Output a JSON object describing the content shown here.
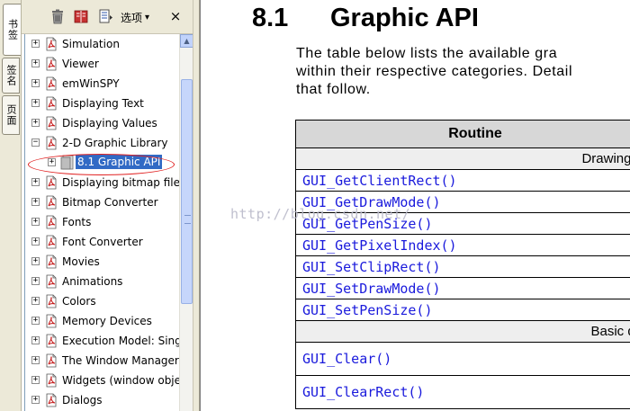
{
  "left_tabs": [
    "书签",
    "签名",
    "页面"
  ],
  "toolbar": {
    "options_label": "选项",
    "options_arrow": "▾",
    "close_label": "×"
  },
  "bookmarks": {
    "items": [
      {
        "label": "Simulation",
        "expander": "+"
      },
      {
        "label": "Viewer",
        "expander": "+"
      },
      {
        "label": "emWinSPY",
        "expander": "+"
      },
      {
        "label": "Displaying Text",
        "expander": "+"
      },
      {
        "label": "Displaying Values",
        "expander": "+"
      },
      {
        "label": "2-D Graphic Library",
        "expander": "−"
      },
      {
        "label": "8.1 Graphic API",
        "expander": "+",
        "selected": true
      },
      {
        "label": "Displaying bitmap files",
        "expander": "+"
      },
      {
        "label": "Bitmap Converter",
        "expander": "+"
      },
      {
        "label": "Fonts",
        "expander": "+"
      },
      {
        "label": "Font Converter",
        "expander": "+"
      },
      {
        "label": "Movies",
        "expander": "+"
      },
      {
        "label": "Animations",
        "expander": "+"
      },
      {
        "label": "Colors",
        "expander": "+"
      },
      {
        "label": "Memory Devices",
        "expander": "+"
      },
      {
        "label": "Execution Model: Singl",
        "expander": "+"
      },
      {
        "label": "The Window Manager",
        "expander": "+"
      },
      {
        "label": "Widgets (window obje",
        "expander": "+"
      },
      {
        "label": "Dialogs",
        "expander": "+"
      }
    ]
  },
  "document": {
    "section_number": "8.1",
    "section_title": "Graphic API",
    "paragraph_lines": [
      "The table below lists the available gra",
      "within their respective categories. Detail",
      "that follow."
    ],
    "table": {
      "header": "Routine",
      "category_drawing": "Drawing re",
      "drawing_routines": [
        "GUI_GetClientRect()",
        "GUI_GetDrawMode()",
        "GUI_GetPenSize()",
        "GUI_GetPixelIndex()",
        "GUI_SetClipRect()",
        "GUI_SetDrawMode()",
        "GUI_SetPenSize()"
      ],
      "category_basic": "Basic dra",
      "basic_routines": [
        "GUI_Clear()",
        "GUI_ClearRect()"
      ]
    },
    "watermark": "http://blog.csdn.net/"
  },
  "colors": {
    "selection": "#316ac5",
    "link_blue": "#1a1adc",
    "highlight_oval": "#e02020",
    "panel_bg": "#ece9d8"
  },
  "icons": {
    "toolbar": [
      "trash-icon",
      "bookmark-book-icon",
      "page-options-icon"
    ],
    "tree_item": "pdf-bookmark-icon",
    "tree_child": "page-icon"
  }
}
